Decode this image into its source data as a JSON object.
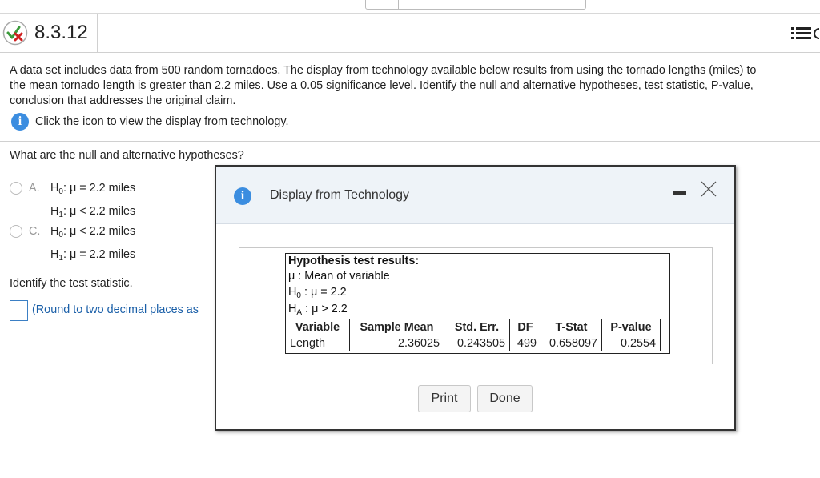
{
  "header": {
    "question_number": "8.3.12"
  },
  "question": {
    "lines": [
      "A data set includes data from 500 random tornadoes. The display from technology available below results from using the tornado lengths (miles) to",
      "the mean tornado length is greater than 2.2 miles. Use a 0.05 significance level. Identify the null and alternative hypotheses, test statistic, P-value,",
      "conclusion that addresses the original claim."
    ],
    "info_text": "Click the icon to view the display from technology."
  },
  "hypotheses": {
    "prompt": "What are the null and alternative hypotheses?",
    "options": [
      {
        "letter": "A.",
        "h0": {
          "rel": "=",
          "value": "2.2 miles"
        },
        "h1": {
          "rel": "<",
          "value": "2.2 miles"
        }
      },
      {
        "letter": "C.",
        "h0": {
          "rel": "<",
          "value": "2.2 miles"
        },
        "h1": {
          "rel": "=",
          "value": "2.2 miles"
        }
      }
    ]
  },
  "test_statistic": {
    "prompt": "Identify the test statistic.",
    "note": "(Round to two decimal places as"
  },
  "dialog": {
    "title": "Display from Technology",
    "tech": {
      "heading": "Hypothesis test results:",
      "mu_def": ": Mean of variable",
      "h0": ": μ = 2.2",
      "ha": ": μ > 2.2",
      "columns": [
        "Variable",
        "Sample Mean",
        "Std. Err.",
        "DF",
        "T-Stat",
        "P-value"
      ],
      "row": [
        "Length",
        "2.36025",
        "0.243505",
        "499",
        "0.658097",
        "0.2554"
      ]
    },
    "print_label": "Print",
    "done_label": "Done"
  },
  "colors": {
    "accent": "#3b8de0",
    "link": "#1a5fa8",
    "dialog_header": "#eef3f8"
  }
}
